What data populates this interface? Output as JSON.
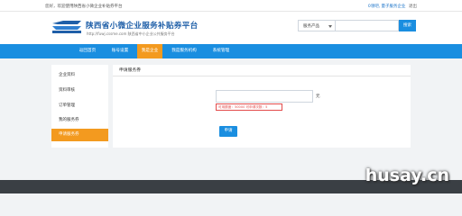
{
  "topbar": {
    "welcome": "您好，欢迎使用陕西省小微企业补贴券平台",
    "user_link": "0领吧, 量子服务企业",
    "logout": "退出"
  },
  "header": {
    "title": "陕西省小微企业服务补贴券平台",
    "subtitle": "http://fuwj.cssme.com 陕西省中小企业公共服务平台",
    "logo_icon": "shaanxi-sme-logo"
  },
  "search": {
    "select_value": "服务产品",
    "placeholder": "",
    "button_label": "搜索"
  },
  "nav": {
    "items": [
      {
        "label": "返回首页",
        "active": false
      },
      {
        "label": "账号设置",
        "active": false
      },
      {
        "label": "我是企业",
        "active": true
      },
      {
        "label": "我是服务机构",
        "active": false
      },
      {
        "label": "系统管理",
        "active": false
      }
    ]
  },
  "sidebar": {
    "items": [
      {
        "label": "企业资料",
        "active": false
      },
      {
        "label": "资料审核",
        "active": false
      },
      {
        "label": "订单管理",
        "active": false
      },
      {
        "label": "我的服务券",
        "active": false
      },
      {
        "label": "申请服务券",
        "active": true
      }
    ]
  },
  "main": {
    "title": "申请服务券",
    "amount_value": "",
    "unit": "元",
    "hint": "可用额度：50000 可申请次数：5",
    "apply_label": "申请"
  },
  "watermark": "husay.cn",
  "colors": {
    "primary": "#1a8ee0",
    "accent": "#f39a1f",
    "brand_text": "#1f5fa8",
    "error": "#e34b4b",
    "footer": "#3a3f44"
  }
}
